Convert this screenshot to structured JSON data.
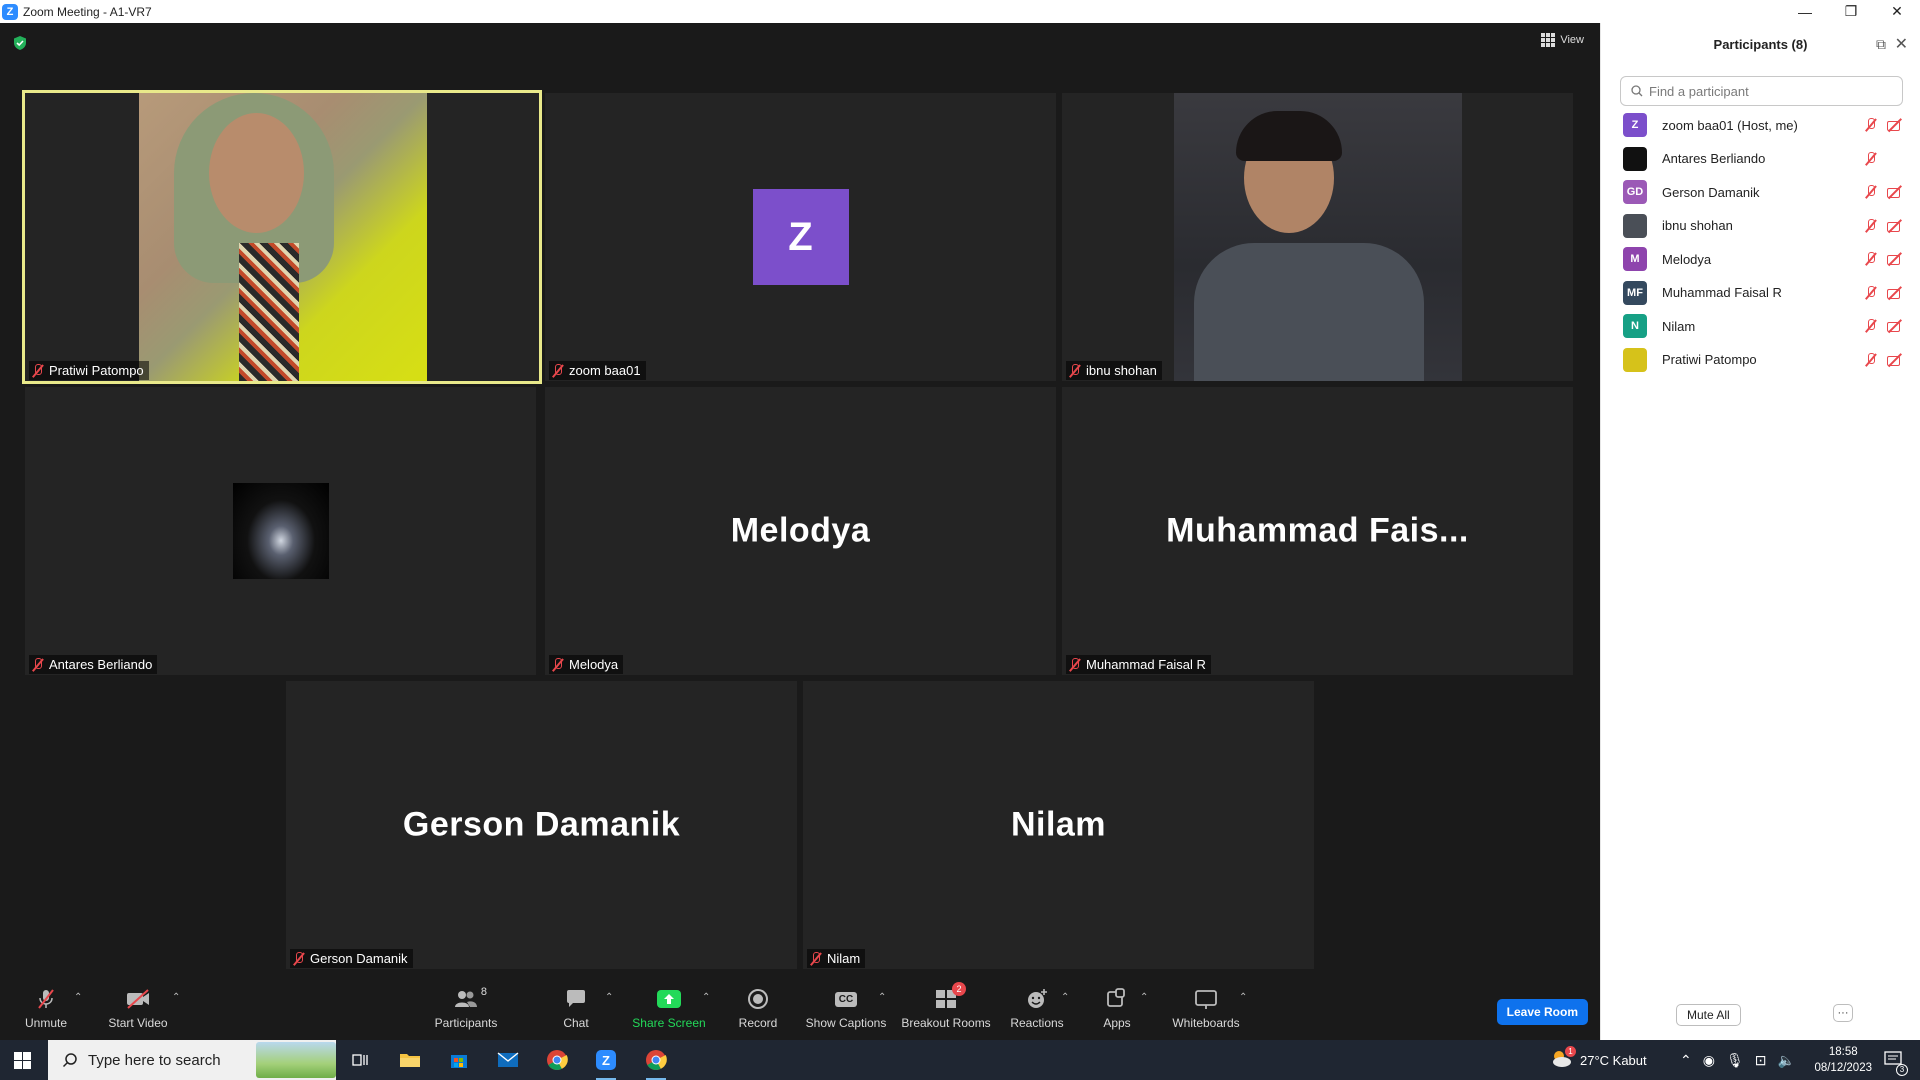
{
  "window": {
    "title": "Zoom Meeting - A1-VR7"
  },
  "meeting": {
    "view_label": "View",
    "tiles": [
      {
        "name": "Pratiwi Patompo",
        "display": "",
        "type": "video-woman",
        "active": true
      },
      {
        "name": "zoom baa01",
        "display": "",
        "avatar_letter": "Z",
        "type": "avatar"
      },
      {
        "name": "ibnu shohan",
        "display": "",
        "type": "video-man"
      },
      {
        "name": "Antares Berliando",
        "display": "",
        "type": "thumb"
      },
      {
        "name": "Melodya",
        "display": "Melodya",
        "type": "name"
      },
      {
        "name": "Muhammad Faisal R",
        "display": "Muhammad  Fais...",
        "type": "name"
      },
      {
        "name": "Gerson Damanik",
        "display": "Gerson Damanik",
        "type": "name"
      },
      {
        "name": "Nilam",
        "display": "Nilam",
        "type": "name"
      }
    ]
  },
  "toolbar": {
    "unmute": "Unmute",
    "start_video": "Start Video",
    "participants": "Participants",
    "participants_count": "8",
    "chat": "Chat",
    "share_screen": "Share Screen",
    "record": "Record",
    "show_captions": "Show Captions",
    "cc": "CC",
    "breakout_rooms": "Breakout Rooms",
    "breakout_badge": "2",
    "reactions": "Reactions",
    "apps": "Apps",
    "whiteboards": "Whiteboards",
    "leave_room": "Leave Room"
  },
  "panel": {
    "title": "Participants (8)",
    "search_placeholder": "Find a participant",
    "participants": [
      {
        "name": "zoom baa01 (Host, me)",
        "initials": "Z",
        "color": "#7c4fcb",
        "mic_off": true,
        "cam_off": true
      },
      {
        "name": "Antares Berliando",
        "initials": "",
        "color": "#111111",
        "mic_off": true,
        "cam_off": false
      },
      {
        "name": "Gerson Damanik",
        "initials": "GD",
        "color": "#9b59b6",
        "mic_off": true,
        "cam_off": true
      },
      {
        "name": "ibnu shohan",
        "initials": "",
        "color": "#4a4f57",
        "mic_off": true,
        "cam_off": true
      },
      {
        "name": "Melodya",
        "initials": "M",
        "color": "#8e44ad",
        "mic_off": true,
        "cam_off": true
      },
      {
        "name": "Muhammad Faisal R",
        "initials": "MF",
        "color": "#34495e",
        "mic_off": true,
        "cam_off": true
      },
      {
        "name": "Nilam",
        "initials": "N",
        "color": "#16a085",
        "mic_off": true,
        "cam_off": true
      },
      {
        "name": "Pratiwi Patompo",
        "initials": "",
        "color": "#d6c21a",
        "mic_off": true,
        "cam_off": true
      }
    ],
    "mute_all": "Mute All",
    "more": "···"
  },
  "taskbar": {
    "search_placeholder": "Type here to search",
    "weather": "27°C  Kabut",
    "weather_badge": "1",
    "time": "18:58",
    "date": "08/12/2023",
    "notifications": "3"
  },
  "colors": {
    "accent": "#0e72ed",
    "active_tile": "#e9e98a",
    "muted": "#e8474c",
    "share_green": "#23d959"
  }
}
